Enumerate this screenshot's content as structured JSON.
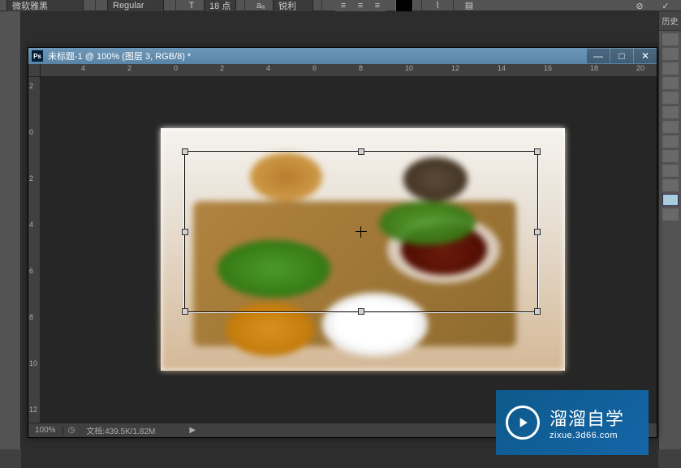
{
  "toolbar": {
    "font_name": "微软雅黑",
    "font_style": "Regular",
    "font_size": "18 点",
    "antialias": "锐利",
    "size_icon_label": "T"
  },
  "right_panel": {
    "tab_label": "历史"
  },
  "doc": {
    "ps_label": "Ps",
    "title": "未标题-1 @ 100% (图层 3, RGB/8) *"
  },
  "ruler_h": [
    "4",
    "2",
    "0",
    "2",
    "4",
    "6",
    "8",
    "10",
    "12",
    "14",
    "16",
    "18",
    "20"
  ],
  "ruler_v": [
    "2",
    "0",
    "2",
    "4",
    "6",
    "8",
    "10",
    "12"
  ],
  "status": {
    "zoom": "100%",
    "info_label": "文档:",
    "info_value": "439.5K/1.82M"
  },
  "watermark": {
    "title": "溜溜自学",
    "url": "zixue.3d66.com"
  }
}
